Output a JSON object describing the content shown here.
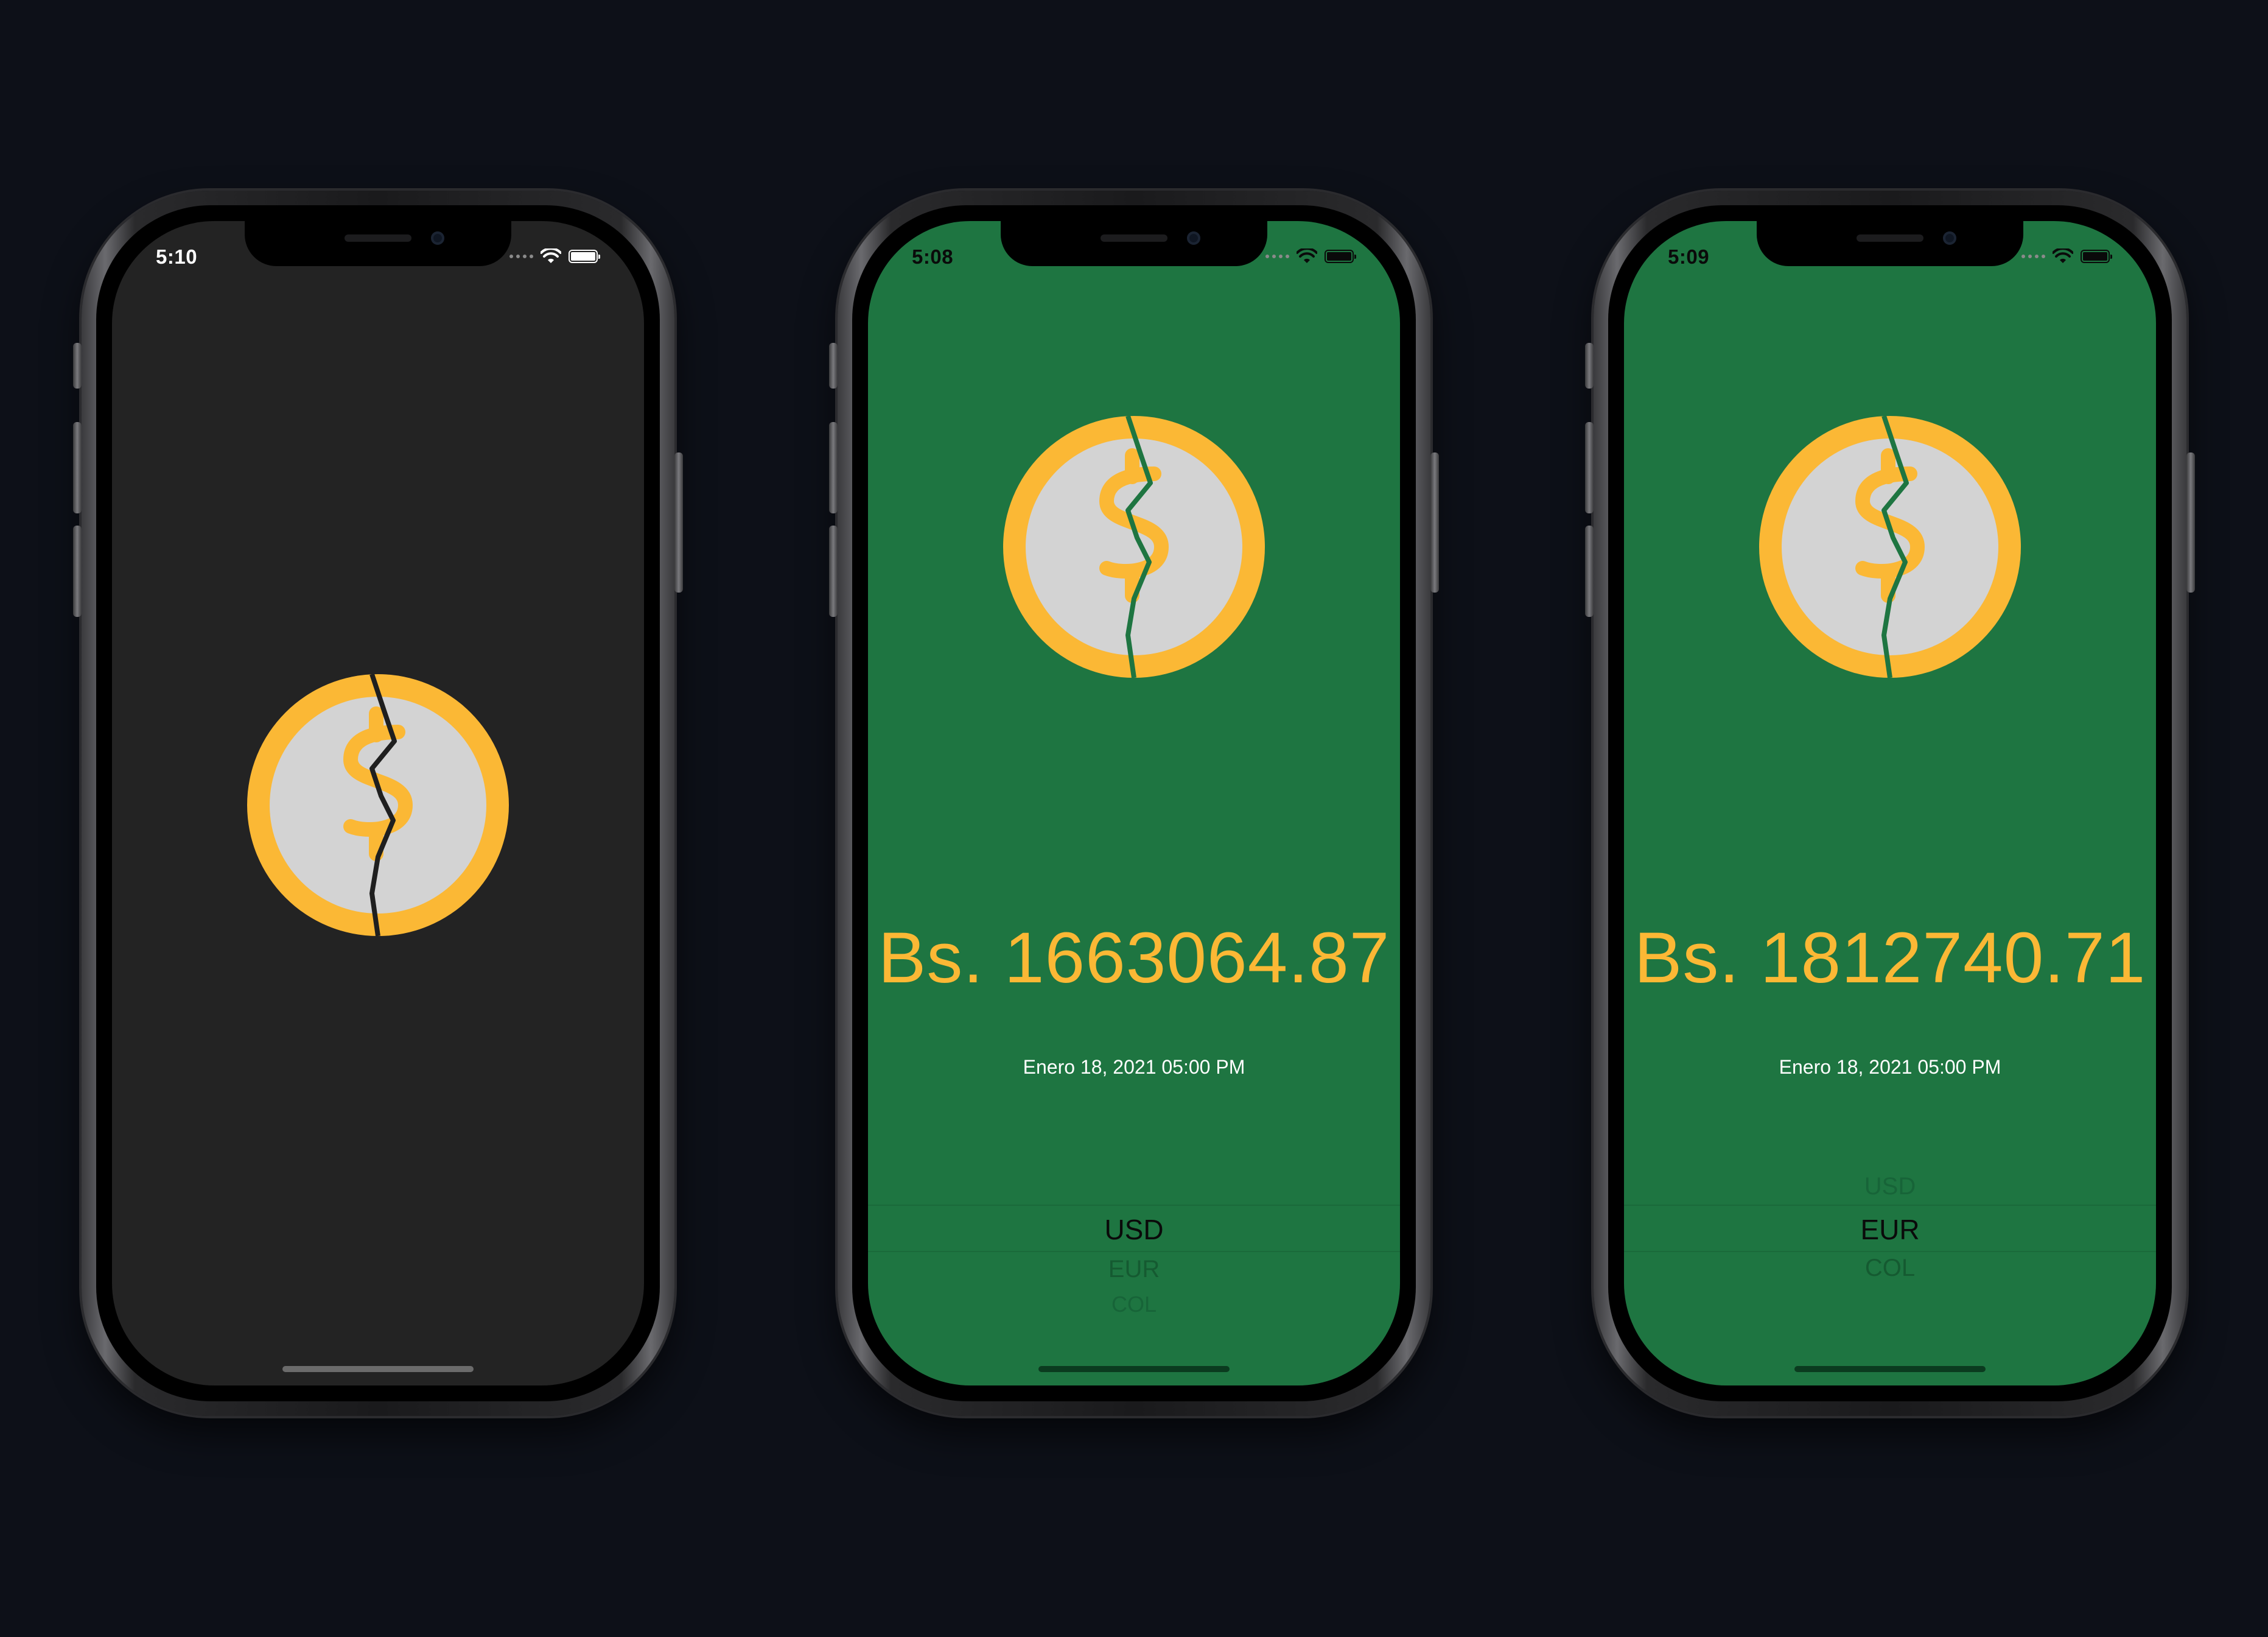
{
  "screens": [
    {
      "time": "5:10",
      "theme": "dark",
      "background": "#232323"
    },
    {
      "time": "5:08",
      "theme": "green",
      "background": "#1e7541",
      "amount": "Bs. 1663064.87",
      "date": "Enero 18, 2021 05:00 PM",
      "picker": {
        "selected": "USD",
        "options": [
          "USD",
          "EUR",
          "COL"
        ]
      }
    },
    {
      "time": "5:09",
      "theme": "green",
      "background": "#1e7541",
      "amount": "Bs. 1812740.71",
      "date": "Enero 18, 2021 05:00 PM",
      "picker": {
        "selected": "EUR",
        "options": [
          "USD",
          "EUR",
          "COL"
        ]
      }
    }
  ],
  "colors": {
    "coin_ring": "#fbb835",
    "coin_face": "#d3d3d3",
    "dollar_sign": "#fbb835",
    "amount_text": "#fbb835",
    "page_background": "#0d1018"
  },
  "icons": [
    "dollar-coin-icon",
    "wifi-icon",
    "battery-icon",
    "signal-dots-icon"
  ]
}
